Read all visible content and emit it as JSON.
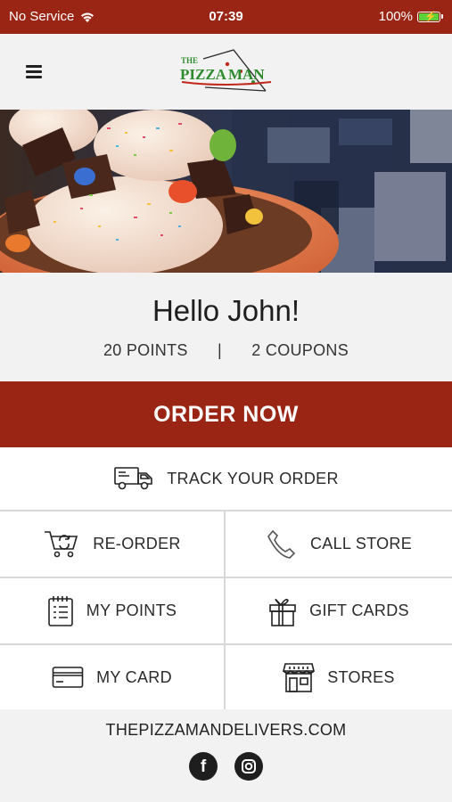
{
  "status_bar": {
    "carrier": "No Service",
    "time": "07:39",
    "battery": "100%"
  },
  "header": {
    "logo_text_top": "THE",
    "logo_text_main": "PIZZA MAN",
    "menu_icon": "hamburger-menu-icon"
  },
  "greeting": "Hello John!",
  "stats": {
    "points": "20 POINTS",
    "separator": "|",
    "coupons": "2 COUPONS"
  },
  "order_now_label": "ORDER NOW",
  "track": {
    "label": "TRACK YOUR ORDER",
    "icon": "delivery-truck-icon"
  },
  "actions": [
    {
      "label": "RE-ORDER",
      "icon": "cart-reload-icon"
    },
    {
      "label": "CALL STORE",
      "icon": "phone-icon"
    },
    {
      "label": "MY POINTS",
      "icon": "notepad-icon"
    },
    {
      "label": "GIFT CARDS",
      "icon": "gift-icon"
    },
    {
      "label": "MY CARD",
      "icon": "credit-card-icon"
    },
    {
      "label": "STORES",
      "icon": "storefront-icon"
    }
  ],
  "footer": {
    "website": "THEPIZZAMANDELIVERS.COM",
    "social": [
      {
        "name": "facebook",
        "glyph": "f"
      },
      {
        "name": "instagram"
      }
    ]
  },
  "colors": {
    "brand_red": "#9a2515",
    "background": "#f2f2f2",
    "logo_green": "#2e8b2e",
    "logo_red": "#c0281b"
  }
}
